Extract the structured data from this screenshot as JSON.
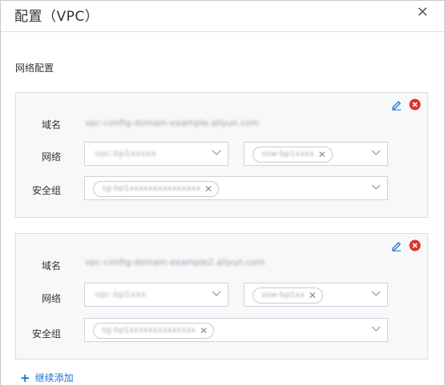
{
  "dialog": {
    "title": "配置（VPC）",
    "close_icon": "close-icon"
  },
  "section": {
    "title": "网络配置"
  },
  "configs": [
    {
      "labels": {
        "domain": "域名",
        "network": "网络",
        "security_group": "安全组"
      },
      "domain_value": "vpc-config-domain-example.aliyun.com",
      "network": {
        "vpc_value": "vpc-bp1xxxxx",
        "vswitch_tag": "vsw-bp1xxxx"
      },
      "security_group_tag": "sg-bp1xxxxxxxxxxxxxxx",
      "actions": {
        "edit_icon": "edit-icon",
        "remove_icon": "remove-icon"
      }
    },
    {
      "labels": {
        "domain": "域名",
        "network": "网络",
        "security_group": "安全组"
      },
      "domain_value": "vpc-config-domain-example2.aliyun.com",
      "network": {
        "vpc_value": "vpc-bp1xxx",
        "vswitch_tag": "vsw-bp1xx"
      },
      "security_group_tag": "sg-bp1xxxxxxxxxxxxxx",
      "actions": {
        "edit_icon": "edit-icon",
        "remove_icon": "remove-icon"
      }
    }
  ],
  "add_more": {
    "label": "继续添加",
    "icon": "plus-icon"
  },
  "colors": {
    "accent": "#1a6fd6",
    "danger": "#e0302f",
    "card_bg": "#f7f8f9"
  }
}
